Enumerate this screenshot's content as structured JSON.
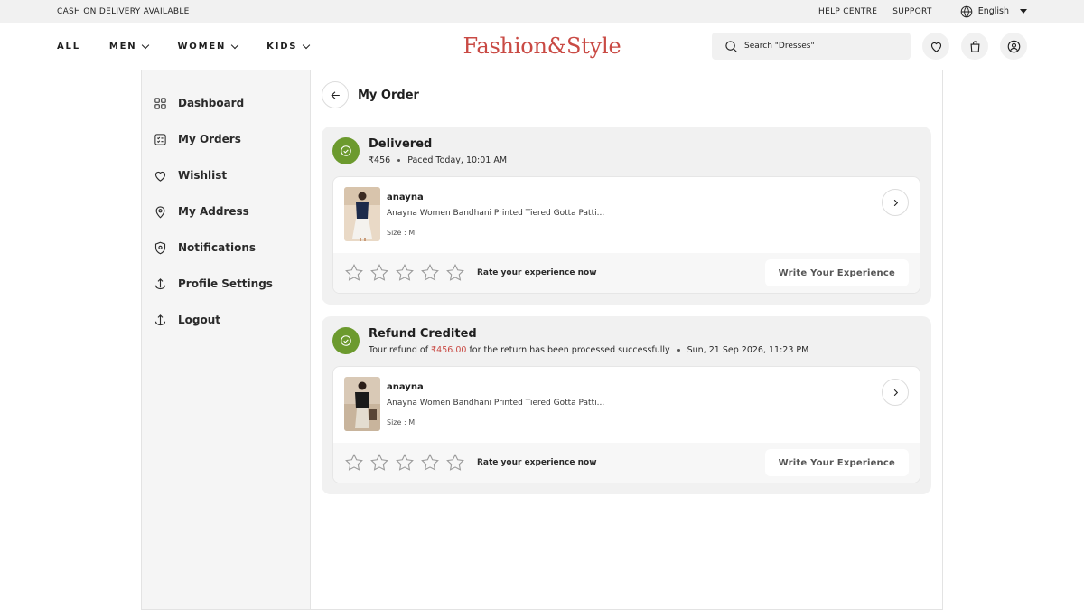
{
  "topbar": {
    "promo": "CASH ON DELIVERY AVAILABLE",
    "help": "HELP CENTRE",
    "support": "SUPPORT",
    "language": "English"
  },
  "header": {
    "nav": [
      {
        "label": "ALL"
      },
      {
        "label": "MEN"
      },
      {
        "label": "WOMEN"
      },
      {
        "label": "KIDS"
      }
    ],
    "logo": "Fashion&Style",
    "search_placeholder": "Search \"Dresses\""
  },
  "sidebar": {
    "items": [
      {
        "label": "Dashboard",
        "icon": "grid-icon"
      },
      {
        "label": "My Orders",
        "icon": "orders-icon"
      },
      {
        "label": "Wishlist",
        "icon": "heart-icon"
      },
      {
        "label": "My Address",
        "icon": "location-pin-icon"
      },
      {
        "label": "Notifications",
        "icon": "shield-icon"
      },
      {
        "label": "Profile Settings",
        "icon": "anchor-icon"
      },
      {
        "label": "Logout",
        "icon": "logout-icon"
      }
    ]
  },
  "main": {
    "title": "My Order",
    "orders": [
      {
        "status": "Delivered",
        "price": "₹456",
        "placed": "Paced Today, 10:01 AM",
        "item": {
          "brand": "anayna",
          "name": "Anayna Women Bandhani Printed Tiered Gotta Patti...",
          "size": "Size : M"
        },
        "rate_text": "Rate your experience now",
        "write_label": "Write Your Experience"
      },
      {
        "status": "Refund Credited",
        "refund_prefix": "Tour refund of",
        "refund_amount": "₹456.00",
        "refund_suffix": "for the return has been processed successfully",
        "refund_date": "Sun, 21 Sep 2026, 11:23 PM",
        "item": {
          "brand": "anayna",
          "name": "Anayna Women Bandhani Printed Tiered Gotta Patti...",
          "size": "Size : M"
        },
        "rate_text": "Rate your experience now",
        "write_label": "Write Your Experience"
      }
    ]
  },
  "colors": {
    "accent": "#c94a44",
    "success": "#6c9a2e"
  }
}
